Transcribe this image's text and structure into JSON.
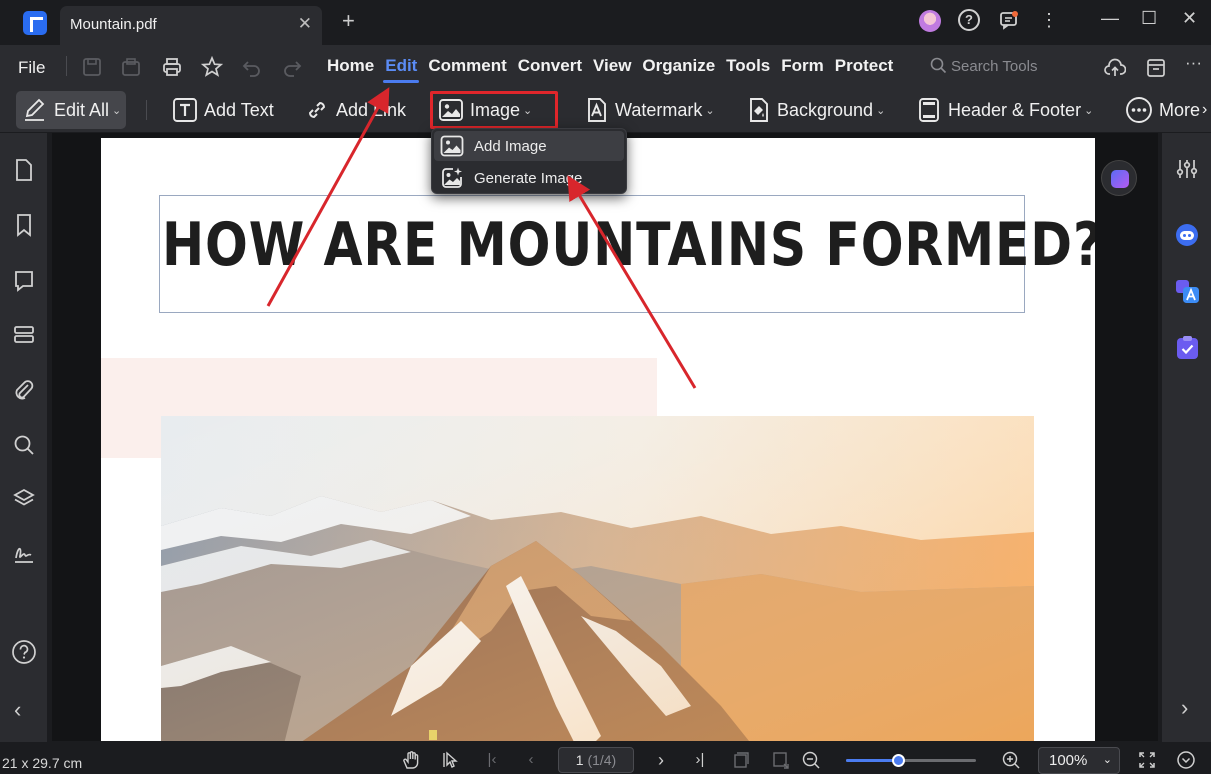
{
  "titlebar": {
    "tab_title": "Mountain.pdf",
    "close_glyph": "✕",
    "new_tab_glyph": "+",
    "help_glyph": "?",
    "kebab_glyph": "⋮",
    "minimize_glyph": "—",
    "maximize_glyph": "☐",
    "close_window_glyph": "✕"
  },
  "menubar": {
    "file": "File",
    "tabs": [
      "Home",
      "Edit",
      "Comment",
      "Convert",
      "View",
      "Organize",
      "Tools",
      "Form",
      "Protect"
    ],
    "active_tab": "Edit",
    "search_placeholder": "Search Tools",
    "more_glyph": "···"
  },
  "toolbar": {
    "edit_all": "Edit All",
    "add_text": "Add Text",
    "add_link": "Add Link",
    "image": "Image",
    "watermark": "Watermark",
    "background": "Background",
    "header_footer": "Header & Footer",
    "more": "More",
    "caret": "⌄"
  },
  "dropdown": {
    "items": [
      "Add Image",
      "Generate Image"
    ]
  },
  "document": {
    "title": "HOW ARE MOUNTAINS FORMED?"
  },
  "statusbar": {
    "page_size": "21 x 29.7 cm",
    "current_page": "1",
    "page_total": "(1/4)",
    "zoom": "100%",
    "zoom_level": 0.4
  },
  "colors": {
    "accent": "#4b7cf0",
    "highlight_box": "#e0262b",
    "annotation_arrow": "#d8262c",
    "chrome_dark": "#1b1c1f",
    "chrome_panel": "#2b2c30"
  }
}
